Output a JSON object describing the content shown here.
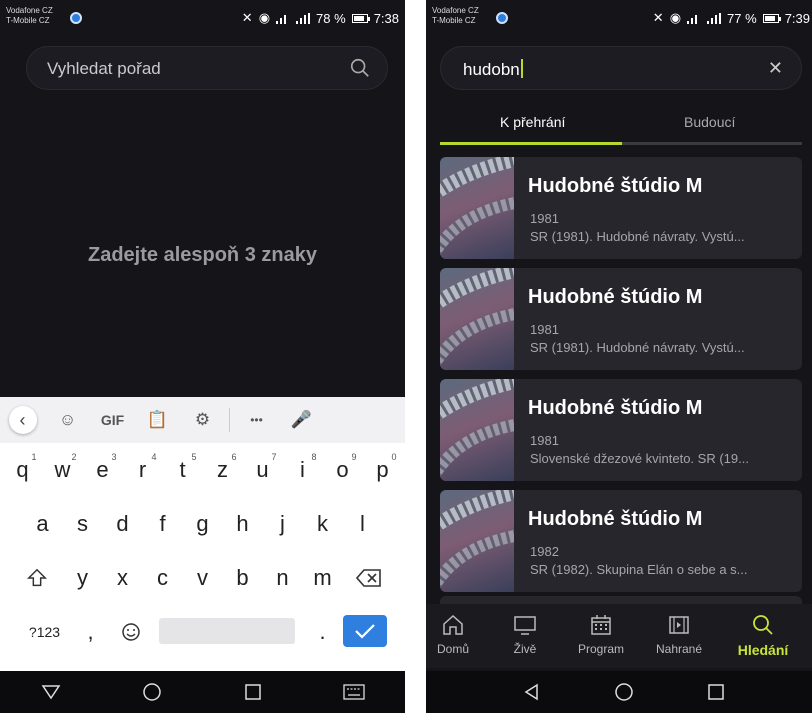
{
  "left": {
    "status": {
      "carrier1": "Vodafone CZ",
      "carrier2": "T-Mobile CZ",
      "battery": "78 %",
      "time": "7:38"
    },
    "search": {
      "placeholder": "Vyhledat pořad"
    },
    "message": "Zadejte alespoň 3 znaky",
    "keyboard": {
      "toolbar": [
        "chevron-left",
        "sticker",
        "GIF",
        "clipboard",
        "settings",
        "more",
        "mic"
      ],
      "gif_label": "GIF",
      "more_label": "•••",
      "row1": [
        {
          "k": "q",
          "n": "1"
        },
        {
          "k": "w",
          "n": "2"
        },
        {
          "k": "e",
          "n": "3"
        },
        {
          "k": "r",
          "n": "4"
        },
        {
          "k": "t",
          "n": "5"
        },
        {
          "k": "z",
          "n": "6"
        },
        {
          "k": "u",
          "n": "7"
        },
        {
          "k": "i",
          "n": "8"
        },
        {
          "k": "o",
          "n": "9"
        },
        {
          "k": "p",
          "n": "0"
        }
      ],
      "row2": [
        "a",
        "s",
        "d",
        "f",
        "g",
        "h",
        "j",
        "k",
        "l"
      ],
      "row3": [
        "y",
        "x",
        "c",
        "v",
        "b",
        "n",
        "m"
      ],
      "symbols_label": "?123",
      "comma": ",",
      "period": "."
    }
  },
  "right": {
    "status": {
      "carrier1": "Vodafone CZ",
      "carrier2": "T-Mobile CZ",
      "battery": "77 %",
      "time": "7:39"
    },
    "search": {
      "value": "hudobn"
    },
    "tabs": {
      "playable": "K přehrání",
      "upcoming": "Budoucí"
    },
    "results": [
      {
        "title": "Hudobné štúdio M",
        "year": "1981",
        "desc": "SR (1981). Hudobné návraty. Vystú..."
      },
      {
        "title": "Hudobné štúdio M",
        "year": "1981",
        "desc": "SR (1981). Hudobné návraty. Vystú..."
      },
      {
        "title": "Hudobné štúdio M",
        "year": "1981",
        "desc": "Slovenské džezové kvinteto. SR (19..."
      },
      {
        "title": "Hudobné štúdio M",
        "year": "1982",
        "desc": "SR (1982). Skupina Elán o sebe a s..."
      }
    ],
    "bottom_nav": [
      {
        "label": "Domů",
        "icon": "home-icon"
      },
      {
        "label": "Živě",
        "icon": "tv-icon"
      },
      {
        "label": "Program",
        "icon": "calendar-icon"
      },
      {
        "label": "Nahrané",
        "icon": "film-icon"
      },
      {
        "label": "Hledání",
        "icon": "search-icon"
      }
    ],
    "accent": "#b6d82f"
  }
}
